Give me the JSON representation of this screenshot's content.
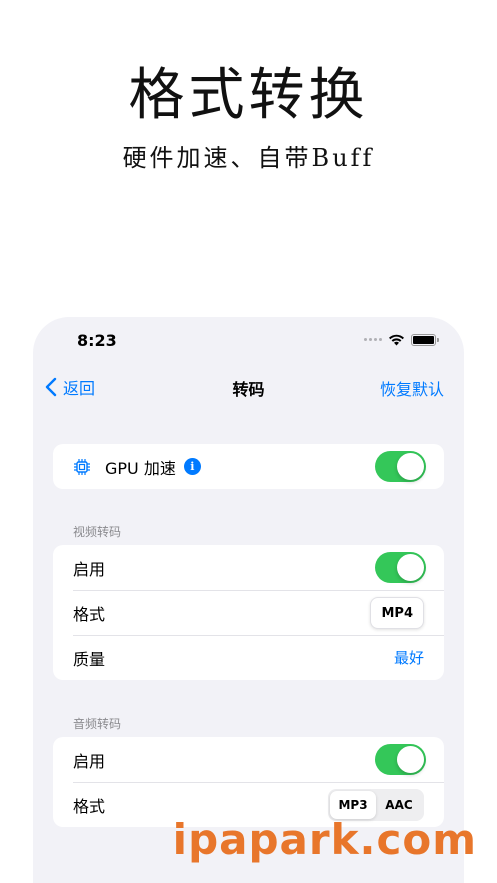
{
  "promo": {
    "title": "格式转换",
    "subtitle": "硬件加速、自带Buff"
  },
  "status_bar": {
    "time": "8:23"
  },
  "navbar": {
    "back_label": "返回",
    "title": "转码",
    "right_label": "恢复默认"
  },
  "gpu": {
    "label": "GPU 加速",
    "enabled": true
  },
  "video": {
    "header": "视频转码",
    "enable_label": "启用",
    "enabled": true,
    "format_label": "格式",
    "format_value": "MP4",
    "quality_label": "质量",
    "quality_value": "最好"
  },
  "audio": {
    "header": "音频转码",
    "enable_label": "启用",
    "enabled": true,
    "format_label": "格式",
    "format_options": [
      "MP3",
      "AAC"
    ],
    "format_selected": "MP3"
  },
  "watermark": "ipapark.com",
  "colors": {
    "accent": "#007aff",
    "toggle_on": "#34c759",
    "background": "#f2f2f7",
    "watermark": "#e8762b"
  }
}
